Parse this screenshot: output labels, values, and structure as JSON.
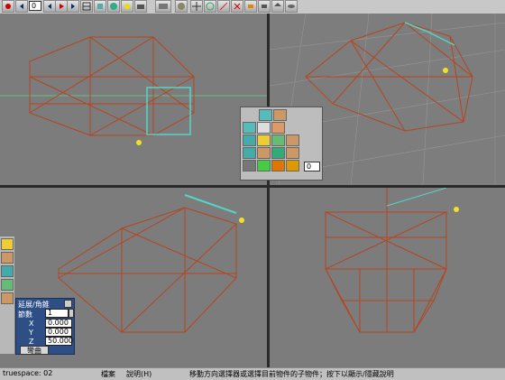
{
  "toolbar": {
    "frame_value": "0",
    "icons": [
      "record-icon",
      "first-frame-icon",
      "prev-frame-icon",
      "play-icon",
      "last-frame-icon",
      "grid-icon",
      "cube-icon",
      "sphere-icon",
      "light-icon",
      "camera-icon",
      "render-icon",
      "material-icon",
      "move-icon",
      "rotate-icon",
      "scale-icon",
      "delete-icon",
      "link-icon",
      "unlink-icon",
      "home-icon",
      "eye-icon"
    ]
  },
  "palette": {
    "frame_value": "0"
  },
  "properties_panel": {
    "title": "延展/角錐",
    "rows": [
      {
        "label": "節數",
        "value": "1"
      },
      {
        "label": "X",
        "value": "0.000"
      },
      {
        "label": "Y",
        "value": "0.000"
      },
      {
        "label": "Z",
        "value": "50.000"
      }
    ],
    "action_label": "彎曲"
  },
  "status_bar": {
    "object_name": "truespace: 02",
    "menu_file": "檔案",
    "menu_help": "說明(H)",
    "hint": "移動方向選擇器或選擇目前物件的子物件；按下以顯示/隱藏說明"
  },
  "colors": {
    "viewport_bg": "#7c7c7c",
    "wire": "#b4451f",
    "selection": "#56d4c6",
    "grid_line": "#9a9a9a"
  }
}
